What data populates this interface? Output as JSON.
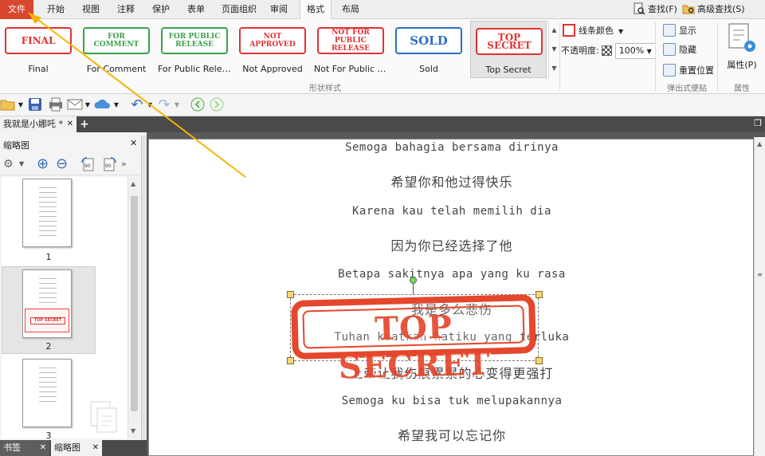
{
  "menu": {
    "tabs": [
      "文件",
      "开始",
      "视图",
      "注释",
      "保护",
      "表单",
      "页面组织",
      "审阅",
      "格式",
      "布局"
    ],
    "find": "查找(F)",
    "advanced_find": "高级查找(S)"
  },
  "ribbon": {
    "stamps": [
      {
        "art": "FINAL",
        "label": "Final"
      },
      {
        "art": "FOR COMMENT",
        "label": "For Comment"
      },
      {
        "art": "FOR PUBLIC RELEASE",
        "label": "For Public Relea.."
      },
      {
        "art": "NOT APPROVED",
        "label": "Not Approved"
      },
      {
        "art": "NOT FOR PUBLIC RELEASE",
        "label": "Not For Public R.."
      },
      {
        "art": "SOLD",
        "label": "Sold"
      },
      {
        "art": "TOP SECRET",
        "label": "Top Secret"
      }
    ],
    "group_shape_style": "形状样式",
    "line_color": "线条颜色",
    "opacity_label": "不透明度:",
    "opacity_value": "100%",
    "show": "显示",
    "hide": "隐藏",
    "reset_position": "重置位置",
    "group_popup_note": "弹出式便贴",
    "properties": "属性(P)",
    "group_properties": "属性"
  },
  "document_tab": {
    "title": "我就是小娜吒 *"
  },
  "left_panel": {
    "title": "缩略图",
    "page_numbers": [
      "1",
      "2",
      "3"
    ],
    "mini_stamp": "TOP SECRET"
  },
  "bottom_tabs": {
    "bookmarks": "书签",
    "thumbnails": "缩略图"
  },
  "page": {
    "lines": [
      "Semoga bahagia bersama dirinya",
      "希望你和他过得快乐",
      "Karena kau telah memilih dia",
      "因为你已经选择了他",
      "Betapa sakitnya apa yang ku rasa",
      "我是多么悲伤",
      "Tuhan kuatkan hatiku yang terluka",
      "上帝让我伤痕累累的心变得更强打",
      "Semoga ku bisa tuk melupakannya",
      "希望我可以忘记你"
    ],
    "stamp_text": "TOP SECRET"
  },
  "colors": {
    "file_tab": "#d9472e",
    "stamp_red": "#e4472c",
    "arrow": "#f5b400"
  }
}
